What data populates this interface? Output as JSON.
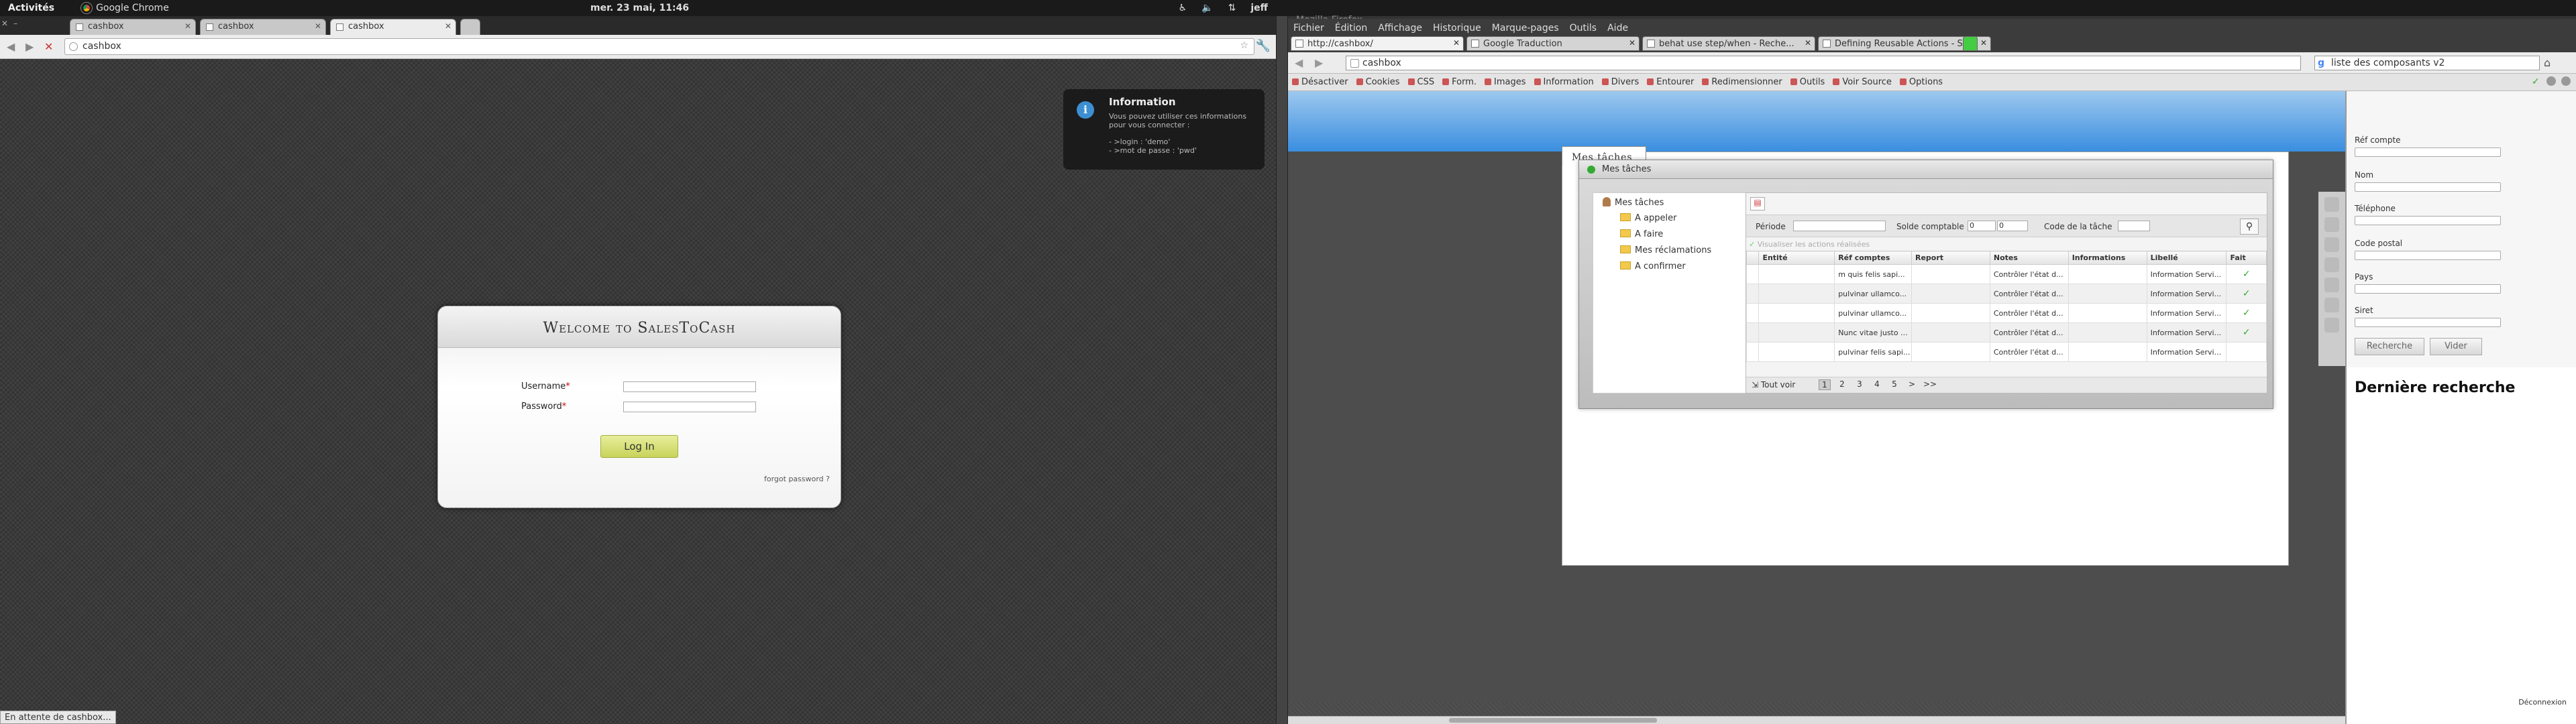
{
  "panel": {
    "activities": "Activités",
    "app": "Google Chrome",
    "clock": "mer. 23 mai, 11:46",
    "user": "jeff"
  },
  "chrome": {
    "tabs": [
      {
        "label": "cashbox"
      },
      {
        "label": "cashbox"
      },
      {
        "label": "cashbox"
      }
    ],
    "url": "cashbox",
    "status": "En attente de cashbox..."
  },
  "info": {
    "title": "Information",
    "body": "Vous pouvez utiliser ces informations pour vous connecter :",
    "login": "- >login : 'demo'",
    "password": "- >mot de passe : 'pwd'"
  },
  "login": {
    "title": "Welcome to SalesToCash",
    "username_label": "Username",
    "password_label": "Password",
    "button": "Log In",
    "forgot": "forgot password ?",
    "required_mark": "*"
  },
  "firefox": {
    "title": "Mozilla Firefox",
    "menu": [
      "Fichier",
      "Édition",
      "Affichage",
      "Historique",
      "Marque-pages",
      "Outils",
      "Aide"
    ],
    "tabs": [
      {
        "label": "http://cashbox/"
      },
      {
        "label": "Google Traduction"
      },
      {
        "label": "behat use step/when - Reche..."
      },
      {
        "label": "Defining Reusable Actions - S..."
      }
    ],
    "url": "cashbox",
    "search": "liste des composants v2",
    "devbar": [
      "Désactiver",
      "Cookies",
      "CSS",
      "Form.",
      "Images",
      "Information",
      "Divers",
      "Entourer",
      "Redimensionner",
      "Outils",
      "Voir Source",
      "Options"
    ]
  },
  "app": {
    "tab": "Mes tâches",
    "window_title": "Mes tâches",
    "tree": {
      "root": "Mes tâches",
      "items": [
        "A appeler",
        "A faire",
        "Mes réclamations",
        "A confirmer"
      ]
    },
    "filter": {
      "periode": "Période",
      "solde": "Solde comptable",
      "solde_from": "0",
      "solde_to": "0",
      "code": "Code de la tâche"
    },
    "show_done": "Visualiser les actions réalisées",
    "columns": [
      "Entité",
      "Réf comptes",
      "Report",
      "Notes",
      "Informations",
      "Libellé",
      "Fait"
    ],
    "rows": [
      [
        "",
        "m quis felis sapi...",
        "",
        "Contrôler l'état d...",
        "",
        "Information Servi...",
        "✓"
      ],
      [
        "",
        "pulvinar ullamco...",
        "",
        "Contrôler l'état d...",
        "",
        "Information Servi...",
        "✓"
      ],
      [
        "",
        "pulvinar ullamco...",
        "",
        "Contrôler l'état d...",
        "",
        "Information Servi...",
        "✓"
      ],
      [
        "",
        "Nunc vitae justo ...",
        "",
        "Contrôler l'état d...",
        "",
        "Information Servi...",
        "✓"
      ],
      [
        "",
        "pulvinar felis sapi...",
        "",
        "Contrôler l'état d...",
        "",
        "Information Servi...",
        ""
      ]
    ],
    "pager": {
      "all": "Tout voir",
      "pages": [
        "1",
        "2",
        "3",
        "4",
        "5",
        ">",
        ">>"
      ]
    }
  },
  "sidebar": {
    "fields": [
      "Réf compte",
      "Nom",
      "Téléphone",
      "Code postal",
      "Pays",
      "Siret"
    ],
    "search_btn": "Recherche",
    "clear_btn": "Vider",
    "last_search": "Dernière recherche",
    "logout": "Déconnexion"
  }
}
